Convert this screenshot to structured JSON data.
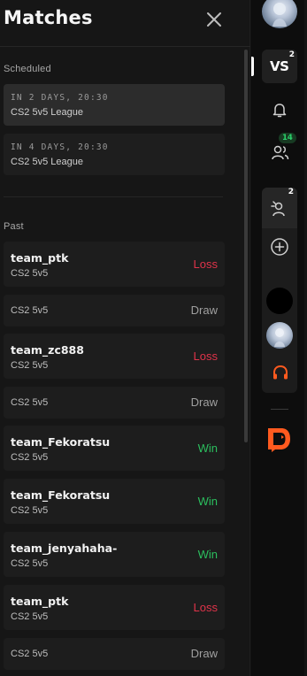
{
  "panel": {
    "title": "Matches",
    "close_icon": "close-icon"
  },
  "scheduled": {
    "label": "Scheduled",
    "items": [
      {
        "when": "IN 2 DAYS, 20:30",
        "league": "CS2 5v5 League"
      },
      {
        "when": "IN 4 DAYS, 20:30",
        "league": "CS2 5v5 League"
      }
    ]
  },
  "past": {
    "label": "Past",
    "items": [
      {
        "team": "team_ptk",
        "game": "CS2 5v5",
        "result": "Loss"
      },
      {
        "team": "",
        "game": "CS2 5v5",
        "result": "Draw"
      },
      {
        "team": "team_zc888",
        "game": "CS2 5v5",
        "result": "Loss"
      },
      {
        "team": "",
        "game": "CS2 5v5",
        "result": "Draw"
      },
      {
        "team": "team_Fekoratsu",
        "game": "CS2 5v5",
        "result": "Win"
      },
      {
        "team": "team_Fekoratsu",
        "game": "CS2 5v5",
        "result": "Win"
      },
      {
        "team": "team_jenyahaha-",
        "game": "CS2 5v5",
        "result": "Win"
      },
      {
        "team": "team_ptk",
        "game": "CS2 5v5",
        "result": "Loss"
      },
      {
        "team": "",
        "game": "CS2 5v5",
        "result": "Draw"
      }
    ]
  },
  "rail": {
    "vs_label": "VS",
    "vs_badge": "2",
    "friends_badge": "14",
    "party_badge": "2",
    "icons": [
      "avatar",
      "vs-icon",
      "bell-icon",
      "friends-icon",
      "party-icon",
      "plus-circle-icon",
      "headset-icon",
      "faceit-logo-icon"
    ]
  },
  "colors": {
    "loss": "#e0334a",
    "win": "#2bbf5e",
    "draw": "#a0a0a0",
    "accent_orange": "#ff5a1f"
  }
}
